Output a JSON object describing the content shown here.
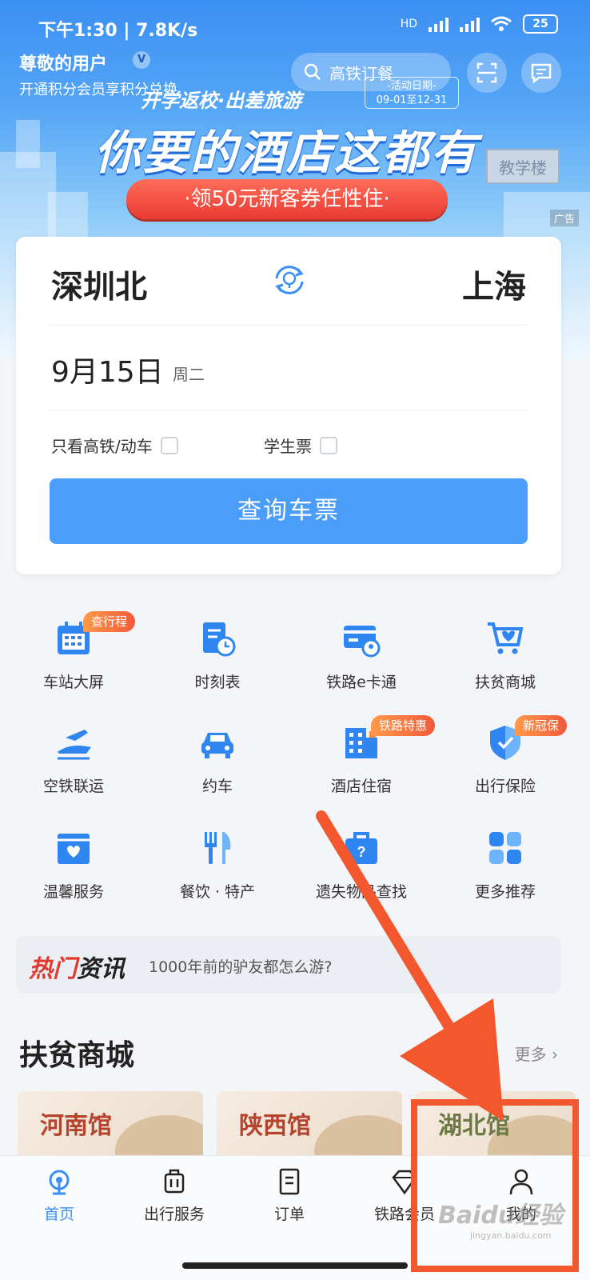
{
  "status": {
    "time": "下午1:30 | 7.8K/s",
    "network": "HD",
    "battery": "25"
  },
  "header": {
    "user_name": "尊敬的用户",
    "vip": "V",
    "user_sub": "开通积分会员享积分兑换",
    "search": "高铁订餐"
  },
  "banner": {
    "tagline": "开学返校·出差旅游",
    "date_label": "-活动日期-",
    "date_range": "09-01至12-31",
    "title": "你要的酒店这都有",
    "coupon": "·领50元新客券任性住·",
    "sign": "教学楼",
    "ad": "广告"
  },
  "ticket": {
    "from": "深圳北",
    "to": "上海",
    "date": "9月15日",
    "weekday": "周二",
    "opt_fast": "只看高铁/动车",
    "opt_student": "学生票",
    "query": "查询车票"
  },
  "services": [
    {
      "label": "车站大屏",
      "badge": "查行程",
      "icon": "station-screen-icon",
      "color": "#2f86f0"
    },
    {
      "label": "时刻表",
      "badge": "",
      "icon": "timetable-icon",
      "color": "#2f86f0"
    },
    {
      "label": "铁路e卡通",
      "badge": "",
      "icon": "rail-card-icon",
      "color": "#2f86f0"
    },
    {
      "label": "扶贫商城",
      "badge": "",
      "icon": "shopping-cart-icon",
      "color": "#2f86f0"
    },
    {
      "label": "空铁联运",
      "badge": "",
      "icon": "air-rail-icon",
      "color": "#2f86f0"
    },
    {
      "label": "约车",
      "badge": "",
      "icon": "car-icon",
      "color": "#2f86f0"
    },
    {
      "label": "酒店住宿",
      "badge": "铁路特惠",
      "icon": "hotel-icon",
      "color": "#2f86f0"
    },
    {
      "label": "出行保险",
      "badge": "新冠保",
      "icon": "shield-icon",
      "color": "#2f86f0"
    },
    {
      "label": "温馨服务",
      "badge": "",
      "icon": "heart-box-icon",
      "color": "#2f86f0"
    },
    {
      "label": "餐饮 · 特产",
      "badge": "",
      "icon": "dining-icon",
      "color": "#2f86f0"
    },
    {
      "label": "遗失物品查找",
      "badge": "",
      "icon": "lost-found-icon",
      "color": "#2f86f0"
    },
    {
      "label": "更多推荐",
      "badge": "",
      "icon": "more-apps-icon",
      "color": "#2f86f0"
    }
  ],
  "news": {
    "logo_hot": "热门",
    "logo_rest": "资讯",
    "text": "1000年前的驴友都怎么游?"
  },
  "mall": {
    "title": "扶贫商城",
    "more": "更多",
    "cards": [
      "河南馆",
      "陕西馆",
      "湖北馆"
    ]
  },
  "tabs": [
    {
      "label": "首页",
      "icon": "home-icon",
      "active": true
    },
    {
      "label": "出行服务",
      "icon": "luggage-icon",
      "active": false
    },
    {
      "label": "订单",
      "icon": "order-icon",
      "active": false
    },
    {
      "label": "铁路会员",
      "icon": "diamond-icon",
      "active": false
    },
    {
      "label": "我的",
      "icon": "person-icon",
      "active": false
    }
  ],
  "watermark": {
    "brand": "Baidu经验",
    "url": "jingyan.baidu.com"
  },
  "colors": {
    "accent": "#4a9df8",
    "annotation": "#f2572d",
    "badge": "#f25a3a"
  }
}
